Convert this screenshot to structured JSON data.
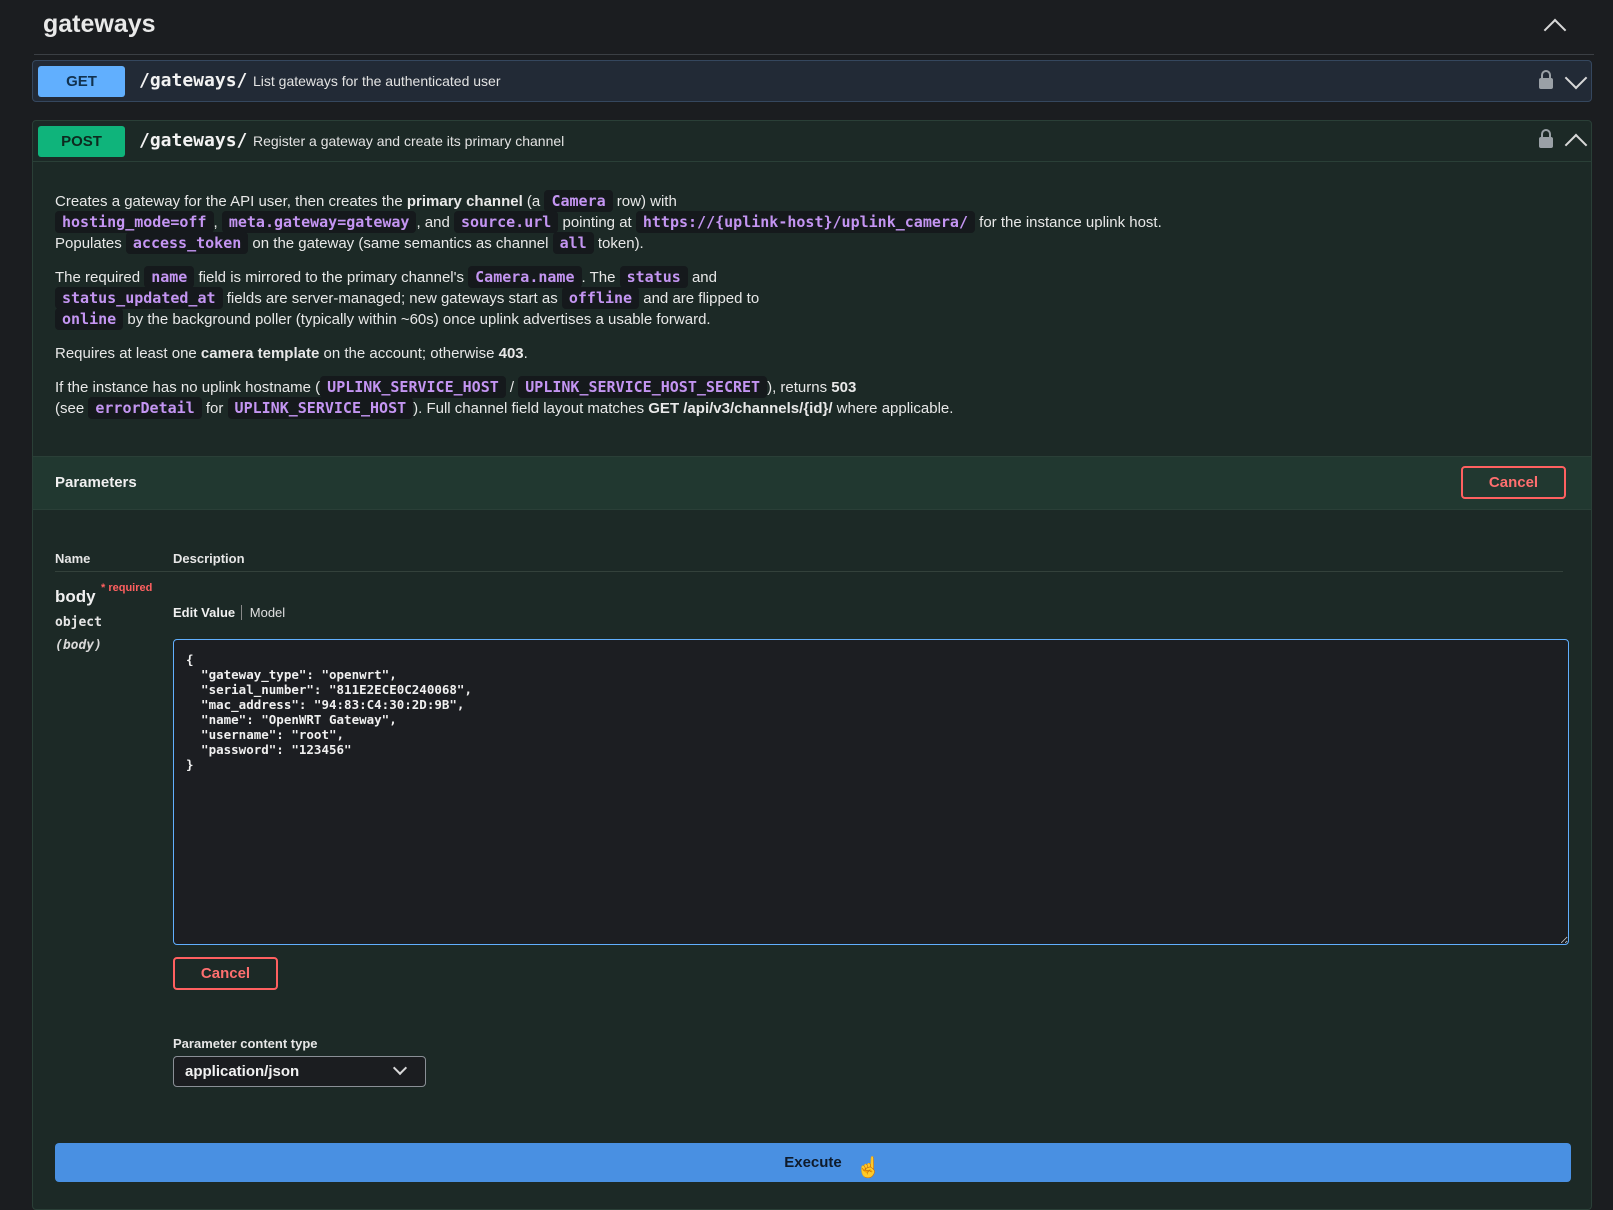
{
  "tag": {
    "title": "gateways"
  },
  "get_op": {
    "method": "GET",
    "path": "/gateways/",
    "summary": "List gateways for the authenticated user"
  },
  "post_op": {
    "method": "POST",
    "path": "/gateways/",
    "summary": "Register a gateway and create its primary channel",
    "description": {
      "p1_a": "Creates a gateway for the API user, then creates the ",
      "p1_b": "primary channel",
      "p1_c": " (a ",
      "p1_code1": "Camera",
      "p1_d": " row) with",
      "p1_code2": "hosting_mode=off",
      "p1_e": ", ",
      "p1_code3": "meta.gateway=gateway",
      "p1_f": ", and ",
      "p1_code4": "source.url",
      "p1_g": " pointing at ",
      "p1_code5": "https://{uplink-host}/uplink_camera/",
      "p1_h": " for the instance uplink host.",
      "p1_i": "Populates ",
      "p1_code6": "access_token",
      "p1_j": " on the gateway (same semantics as channel ",
      "p1_code7": "all",
      "p1_k": " token).",
      "p2_a": "The required ",
      "p2_code1": "name",
      "p2_b": " field is mirrored to the primary channel's ",
      "p2_code2": "Camera.name",
      "p2_c": ". The ",
      "p2_code3": "status",
      "p2_d": " and",
      "p2_code4": "status_updated_at",
      "p2_e": " fields are server-managed; new gateways start as ",
      "p2_code5": "offline",
      "p2_f": " and are flipped to",
      "p2_code6": "online",
      "p2_g": " by the background poller (typically within ~60s) once uplink advertises a usable forward.",
      "p3_a": "Requires at least one ",
      "p3_b": "camera template",
      "p3_c": " on the account; otherwise ",
      "p3_d": "403",
      "p3_e": ".",
      "p4_a": "If the instance has no uplink hostname (",
      "p4_code1": "UPLINK_SERVICE_HOST",
      "p4_b": " / ",
      "p4_code2": "UPLINK_SERVICE_HOST_SECRET",
      "p4_c": "), returns ",
      "p4_d": "503",
      "p4_e": "(see ",
      "p4_code3": "errorDetail",
      "p4_f": " for ",
      "p4_code4": "UPLINK_SERVICE_HOST",
      "p4_g": "). Full channel field layout matches ",
      "p4_h": "GET /api/v3/channels/{id}/",
      "p4_i": " where applicable."
    }
  },
  "parameters": {
    "title": "Parameters",
    "cancel_label": "Cancel",
    "col_name": "Name",
    "col_description": "Description",
    "body": {
      "name": "body",
      "required": "* required",
      "type": "object",
      "in": "(body)",
      "tab_edit": "Edit Value",
      "tab_model": "Model",
      "value": "{\n  \"gateway_type\": \"openwrt\",\n  \"serial_number\": \"811E2ECE0C240068\",\n  \"mac_address\": \"94:83:C4:30:2D:9B\",\n  \"name\": \"OpenWRT Gateway\",\n  \"username\": \"root\",\n  \"password\": \"123456\"\n}"
    },
    "body_cancel_label": "Cancel",
    "content_type_label": "Parameter content type",
    "content_type_value": "application/json"
  },
  "execute_label": "Execute",
  "colors": {
    "get": "#61affe",
    "post": "#0fb47b",
    "cancel": "#ff6060",
    "execute": "#4990e2",
    "code": "#c495f2"
  },
  "icons": [
    "chevron-up-icon",
    "chevron-down-icon",
    "lock-icon",
    "pointer-cursor-icon"
  ]
}
